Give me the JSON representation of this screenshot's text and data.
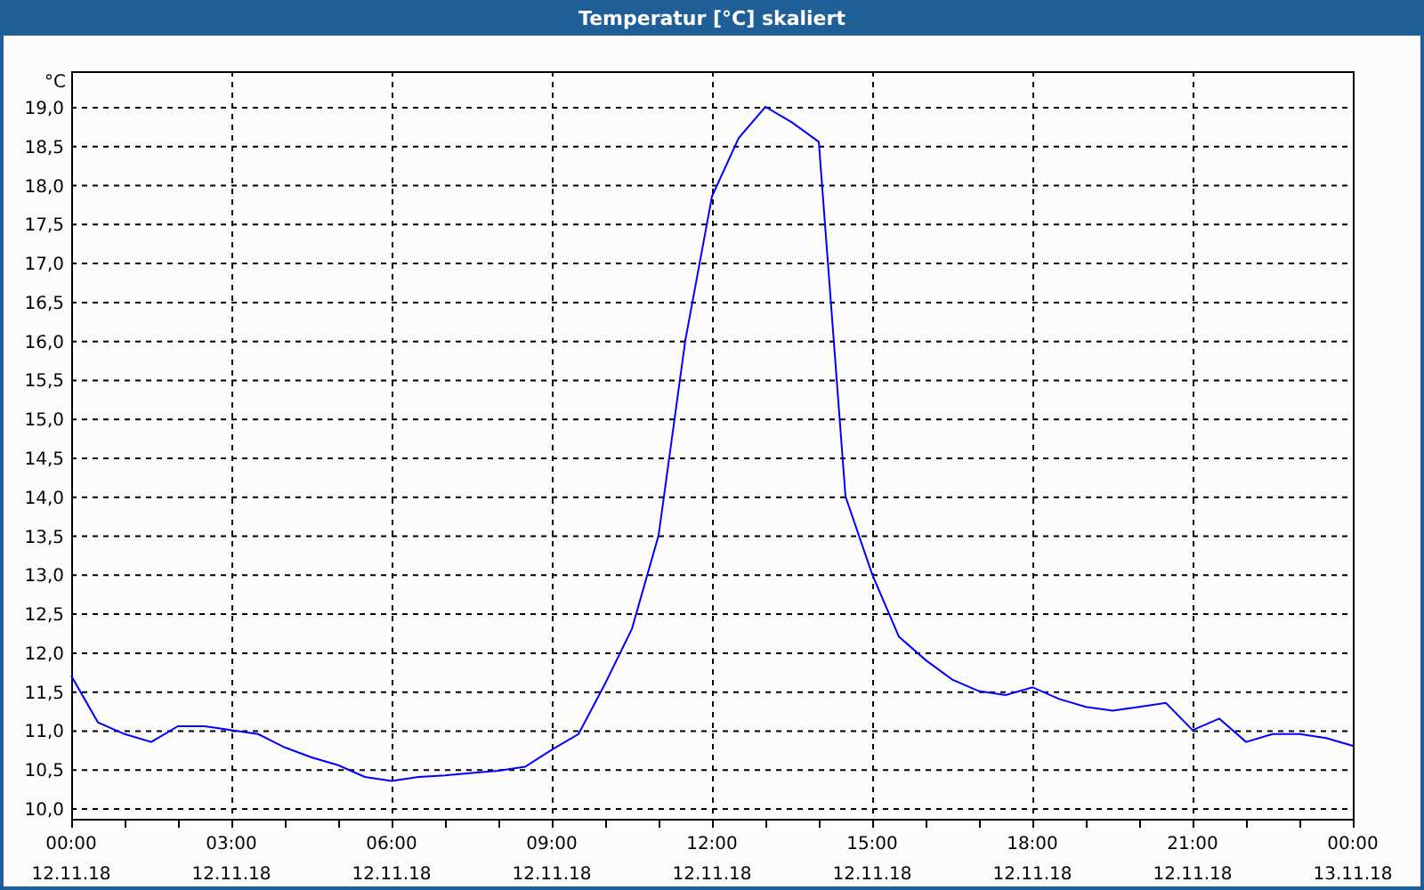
{
  "window": {
    "title": "Temperatur [°C] skaliert"
  },
  "chart": {
    "chart_data": {
      "type": "line",
      "grid": true,
      "ylabel": "°C",
      "ylim": [
        10,
        19
      ],
      "yticks": [
        {
          "value": 10,
          "label": "10,0"
        },
        {
          "value": 10.5,
          "label": "10,5"
        },
        {
          "value": 11,
          "label": "11,0"
        },
        {
          "value": 11.5,
          "label": "11,5"
        },
        {
          "value": 12,
          "label": "12,0"
        },
        {
          "value": 12.5,
          "label": "12,5"
        },
        {
          "value": 13,
          "label": "13,0"
        },
        {
          "value": 13.5,
          "label": "13,5"
        },
        {
          "value": 14,
          "label": "14,0"
        },
        {
          "value": 14.5,
          "label": "14,5"
        },
        {
          "value": 15,
          "label": "15,0"
        },
        {
          "value": 15.5,
          "label": "15,5"
        },
        {
          "value": 16,
          "label": "16,0"
        },
        {
          "value": 16.5,
          "label": "16,5"
        },
        {
          "value": 17,
          "label": "17,0"
        },
        {
          "value": 17.5,
          "label": "17,5"
        },
        {
          "value": 18,
          "label": "18,0"
        },
        {
          "value": 18.5,
          "label": "18,5"
        },
        {
          "value": 19,
          "label": "19,0"
        }
      ],
      "categories": [
        "00:00 12.11.18",
        null,
        null,
        null,
        null,
        null,
        "03:00 12.11.18",
        null,
        null,
        null,
        null,
        null,
        "06:00 12.11.18",
        null,
        null,
        null,
        null,
        null,
        "09:00 12.11.18",
        null,
        null,
        null,
        null,
        null,
        "12:00 12.11.18",
        null,
        null,
        null,
        null,
        null,
        "15:00 12.11.18",
        null,
        null,
        null,
        null,
        null,
        "18:00 12.11.18",
        null,
        null,
        null,
        null,
        null,
        "21:00 12.11.18",
        null,
        null,
        null,
        null,
        null,
        "00:00 13.11.18"
      ],
      "series": [
        {
          "color": "#0000ff",
          "values": [
            11.7,
            11.1,
            10.95,
            10.85,
            11.05,
            11.05,
            11.0,
            10.95,
            10.78,
            10.65,
            10.55,
            10.4,
            10.35,
            10.4,
            10.42,
            10.45,
            10.48,
            10.53,
            10.75,
            10.95,
            11.6,
            12.3,
            13.5,
            16.0,
            17.85,
            18.6,
            19.0,
            18.8,
            18.55,
            14.0,
            13.0,
            12.2,
            11.9,
            11.65,
            11.5,
            11.45,
            11.55,
            11.4,
            11.3,
            11.25,
            11.3,
            11.35,
            11.0,
            11.15,
            10.85,
            10.95,
            10.95,
            10.9,
            10.8
          ]
        }
      ]
    }
  }
}
